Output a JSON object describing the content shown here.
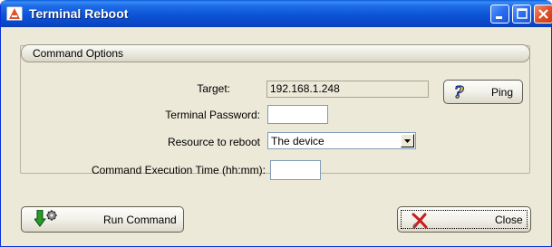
{
  "window": {
    "title": "Terminal Reboot",
    "title_icon": "app-logo-icon",
    "controls": [
      "minimize-icon",
      "maximize-icon",
      "close-icon"
    ]
  },
  "group": {
    "title": "Command Options"
  },
  "form": {
    "target_label": "Target:",
    "target_value": "192.168.1.248",
    "password_label": "Terminal Password:",
    "password_value": "",
    "resource_label": "Resource to reboot",
    "resource_value": "The device",
    "exec_time_label": "Command Execution Time (hh:mm):",
    "exec_time_value": ""
  },
  "buttons": {
    "ping_label": "Ping",
    "ping_icon": "question-mark-icon",
    "run_label": "Run Command",
    "run_icon": "arrow-gear-icon",
    "close_label": "Close",
    "close_icon": "red-x-icon"
  },
  "colors": {
    "titlebar": "#0a48c8",
    "close_button": "#e0522a",
    "dialog_bg": "#ece9d8"
  }
}
